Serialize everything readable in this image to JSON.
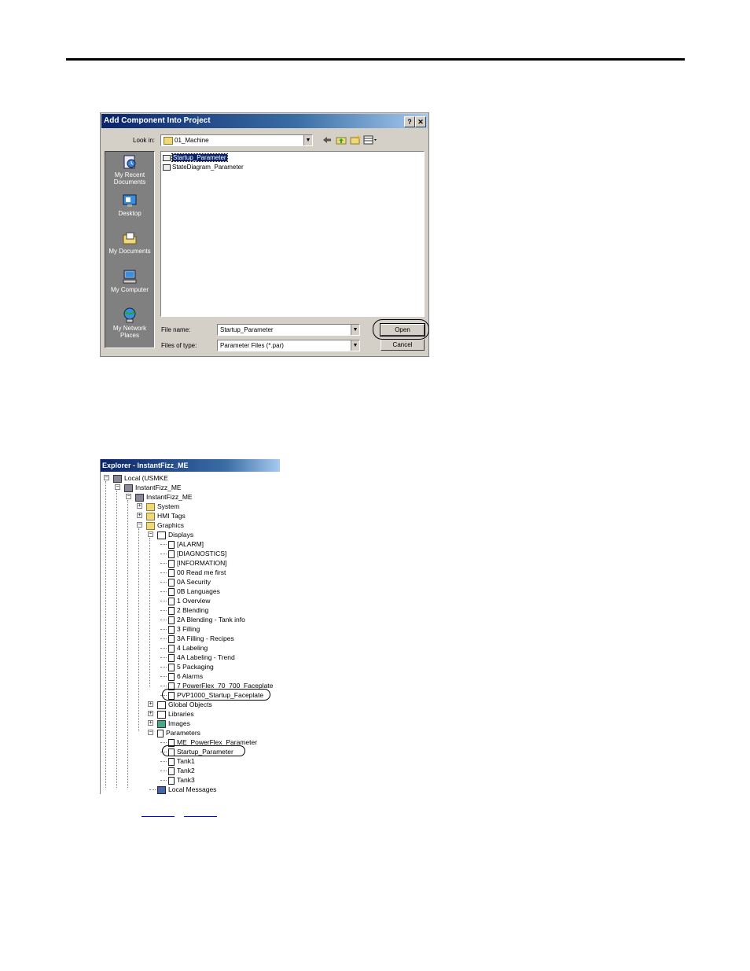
{
  "dialog": {
    "title": "Add Component Into Project",
    "help_glyph": "?",
    "close_glyph": "✕",
    "look_in_label": "Look in:",
    "look_in_value": "01_Machine",
    "places": [
      {
        "label": "My Recent Documents",
        "icon": "recent-documents-icon"
      },
      {
        "label": "Desktop",
        "icon": "desktop-icon"
      },
      {
        "label": "My Documents",
        "icon": "my-documents-icon"
      },
      {
        "label": "My Computer",
        "icon": "my-computer-icon"
      },
      {
        "label": "My Network Places",
        "icon": "network-places-icon"
      }
    ],
    "files": [
      "Startup_Parameter",
      "StateDiagram_Parameter"
    ],
    "file_name_label": "File name:",
    "file_name_value": "Startup_Parameter",
    "file_type_label": "Files of type:",
    "file_type_value": "Parameter Files (*.par)",
    "open_label": "Open",
    "cancel_label": "Cancel"
  },
  "explorer": {
    "title": "Explorer - InstantFizz_ME",
    "nodes": [
      {
        "label": "Local (USMKE",
        "icon": "computer-icon"
      },
      {
        "label": "InstantFizz_ME",
        "icon": "application-icon"
      },
      {
        "label": "InstantFizz_ME",
        "icon": "area-icon"
      },
      {
        "label": "System",
        "icon": "folder-icon"
      },
      {
        "label": "HMI Tags",
        "icon": "folder-icon"
      },
      {
        "label": "Graphics",
        "icon": "folder-icon"
      },
      {
        "label": "Displays",
        "icon": "displays-icon"
      },
      {
        "label": "[ALARM]",
        "icon": "display-icon"
      },
      {
        "label": "[DIAGNOSTICS]",
        "icon": "display-icon"
      },
      {
        "label": "[INFORMATION]",
        "icon": "display-icon"
      },
      {
        "label": "00 Read me first",
        "icon": "display-icon"
      },
      {
        "label": "0A Security",
        "icon": "display-icon"
      },
      {
        "label": "0B Languages",
        "icon": "display-icon"
      },
      {
        "label": "1 Overview",
        "icon": "display-icon"
      },
      {
        "label": "2 Blending",
        "icon": "display-icon"
      },
      {
        "label": "2A Blending - Tank info",
        "icon": "display-icon"
      },
      {
        "label": "3 Filling",
        "icon": "display-icon"
      },
      {
        "label": "3A Filling - Recipes",
        "icon": "display-icon"
      },
      {
        "label": "4 Labeling",
        "icon": "display-icon"
      },
      {
        "label": "4A Labeling - Trend",
        "icon": "display-icon"
      },
      {
        "label": "5 Packaging",
        "icon": "display-icon"
      },
      {
        "label": "6 Alarms",
        "icon": "display-icon"
      },
      {
        "label": "7 PowerFlex_70_700_Faceplate",
        "icon": "display-icon"
      },
      {
        "label": "PVP1000_Startup_Faceplate",
        "icon": "display-icon"
      },
      {
        "label": "Global Objects",
        "icon": "global-objects-icon"
      },
      {
        "label": "Libraries",
        "icon": "libraries-icon"
      },
      {
        "label": "Images",
        "icon": "images-icon"
      },
      {
        "label": "Parameters",
        "icon": "parameters-icon"
      },
      {
        "label": "ME_PowerFlex_Parameter",
        "icon": "parameter-file-icon"
      },
      {
        "label": "Startup_Parameter",
        "icon": "parameter-file-icon"
      },
      {
        "label": "Tank1",
        "icon": "parameter-file-icon"
      },
      {
        "label": "Tank2",
        "icon": "parameter-file-icon"
      },
      {
        "label": "Tank3",
        "icon": "parameter-file-icon"
      },
      {
        "label": "Local Messages",
        "icon": "messages-icon"
      }
    ]
  }
}
